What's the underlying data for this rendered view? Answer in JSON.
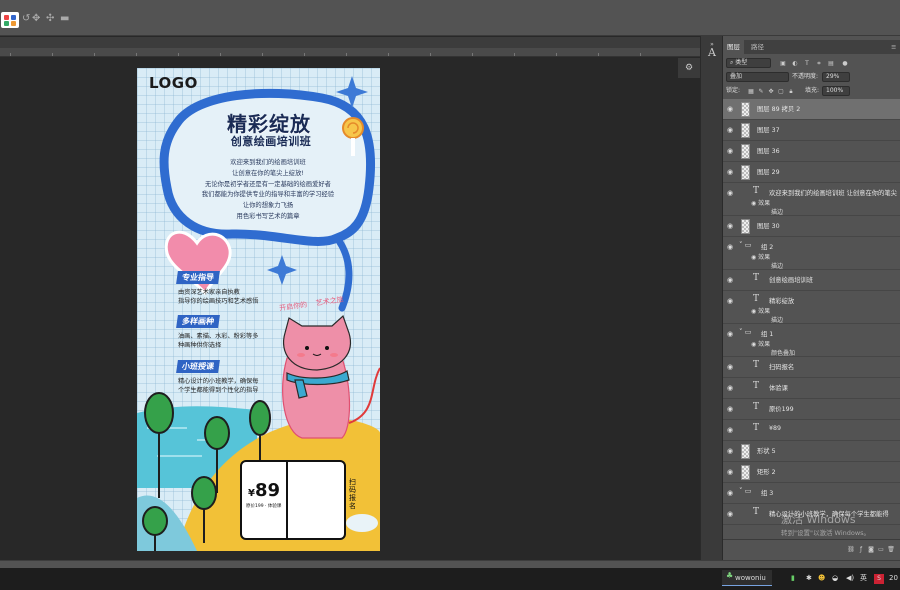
{
  "app": {
    "tabs": {
      "layers": "图层",
      "paths": "路径"
    }
  },
  "layers_panel": {
    "filter": "类型",
    "blend_mode": "叠加",
    "opacity_label": "不透明度:",
    "opacity_value": "29%",
    "lock_label": "锁定:",
    "fill_label": "填充:",
    "fill_value": "100%",
    "layers": [
      {
        "name": "图层 89 拷贝 2",
        "kind": "thumb"
      },
      {
        "name": "图层 37",
        "kind": "thumb"
      },
      {
        "name": "图层 36",
        "kind": "thumb"
      },
      {
        "name": "图层 29",
        "kind": "thumb"
      },
      {
        "name": "欢迎来到我们的绘画培训班 让创意在你的笔尖",
        "kind": "text",
        "fx": "效果",
        "fx_item": "描边"
      },
      {
        "name": "图层 30",
        "kind": "thumb"
      },
      {
        "name": "组 2",
        "kind": "group",
        "fx": "效果",
        "fx_item": "描边"
      },
      {
        "name": "创意绘画培训班",
        "kind": "text"
      },
      {
        "name": "精彩绽放",
        "kind": "text",
        "fx": "效果",
        "fx_item": "描边"
      },
      {
        "name": "组 1",
        "kind": "group",
        "fx": "效果",
        "fx_item": "颜色叠加"
      },
      {
        "name": "扫码报名",
        "kind": "text"
      },
      {
        "name": "体验课",
        "kind": "text"
      },
      {
        "name": "原价199",
        "kind": "text"
      },
      {
        "name": "¥89",
        "kind": "text"
      },
      {
        "name": "形状 5",
        "kind": "shape"
      },
      {
        "name": "矩形 2",
        "kind": "shape"
      },
      {
        "name": "组 3",
        "kind": "group"
      },
      {
        "name": "精心设计的小班教学，确保每个学生都能得",
        "kind": "text"
      }
    ]
  },
  "poster": {
    "logo": "LOGO",
    "title": "精彩绽放",
    "subtitle": "创意绘画培训班",
    "intro_lines": [
      "欢迎来到我们的绘画培训班",
      "让创意在你的笔尖上绽放!",
      "无论你是初学者还是有一定基础的绘画爱好者",
      "我们都能为你提供专业的指导和丰富的学习经验",
      "让你的想象力飞扬",
      "用色彩书写艺术的篇章"
    ],
    "sections": [
      {
        "tag": "专业指导",
        "lines": [
          "由资深艺术家亲自执教",
          "指导你的绘画技巧和艺术感悟"
        ]
      },
      {
        "tag": "多样画种",
        "lines": [
          "油画、素描、水彩、粉彩等多",
          "种画种供你选择"
        ]
      },
      {
        "tag": "小班授课",
        "lines": [
          "精心设计的小班教学，确保每",
          "个学生都能得到个性化的指导"
        ]
      }
    ],
    "cat_caption": "开启你的    艺术之旅",
    "price_symbol": "¥",
    "price": "89",
    "price_sub": "原价199 · 体验课",
    "scan_label": "扫码报名"
  },
  "watermark": {
    "line1": "激活 Windows",
    "line2": "转到\"设置\"以激活 Windows。"
  },
  "taskbar": {
    "app": "wowoniu",
    "ime": "英",
    "time": "20"
  },
  "colors": {
    "accent": "#2f64c4",
    "panel": "#535353",
    "canvas": "#282828"
  }
}
